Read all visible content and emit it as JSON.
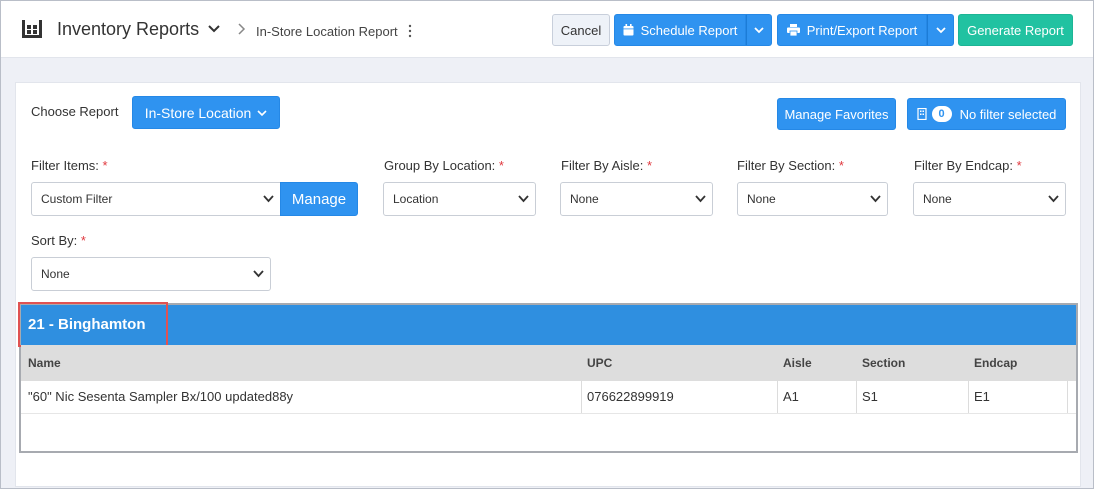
{
  "header": {
    "app_title": "Inventory Reports",
    "breadcrumb": "In-Store Location Report",
    "buttons": {
      "cancel": "Cancel",
      "schedule": "Schedule Report",
      "print": "Print/Export Report",
      "generate": "Generate Report"
    }
  },
  "toolbar": {
    "choose_report_label": "Choose Report",
    "choose_report_value": "In-Store Location",
    "manage_favorites": "Manage Favorites",
    "filter_count": "0",
    "filter_status": "No filter selected"
  },
  "filters": {
    "filter_items": {
      "label": "Filter Items:",
      "value": "Custom Filter",
      "manage": "Manage"
    },
    "group_by_location": {
      "label": "Group By Location:",
      "value": "Location"
    },
    "filter_by_aisle": {
      "label": "Filter By Aisle:",
      "value": "None"
    },
    "filter_by_section": {
      "label": "Filter By Section:",
      "value": "None"
    },
    "filter_by_endcap": {
      "label": "Filter By Endcap:",
      "value": "None"
    },
    "sort_by": {
      "label": "Sort By:",
      "value": "None"
    },
    "required_mark": "*"
  },
  "location": {
    "title": "21 - Binghamton",
    "columns": [
      "Name",
      "UPC",
      "Aisle",
      "Section",
      "Endcap"
    ],
    "rows": [
      [
        "\"60\" Nic Sesenta Sampler Bx/100 updated88y",
        "076622899919",
        "A1",
        "S1",
        "E1"
      ]
    ]
  },
  "colors": {
    "primary": "#2f93f0",
    "success": "#21c2a1",
    "location_header": "#2f8fe0",
    "highlight": "#e05252",
    "required": "#e0383e"
  },
  "icons": {
    "app": "warehouse-icon",
    "title_dropdown": "chevron-down-icon",
    "breadcrumb_separator": "chevron-right-icon",
    "more": "kebab-icon",
    "schedule": "calendar-icon",
    "print": "printer-icon",
    "filter": "filter-building-icon"
  }
}
